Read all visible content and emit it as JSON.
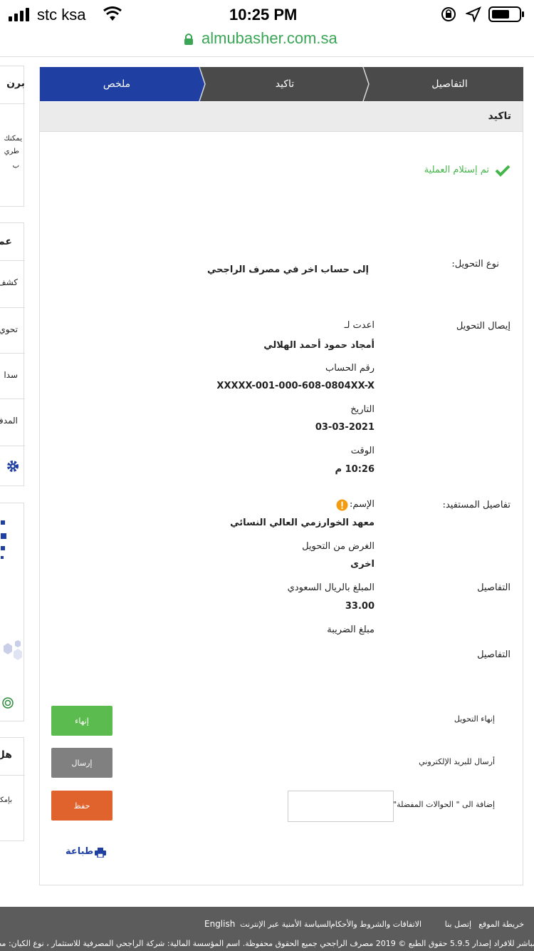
{
  "status_bar": {
    "carrier": "stc ksa",
    "time": "10:25 PM"
  },
  "url_bar": {
    "url": "almubasher.com.sa"
  },
  "sidebar": {
    "card1_title": "برن",
    "card1_text": [
      "يمكنك",
      "طري",
      "ب"
    ],
    "card2_title": "عم",
    "card2_items": [
      "كشف",
      "تحوي",
      "سدا",
      "المدف"
    ],
    "card4_title": "هل",
    "card4_text": "بإمكا"
  },
  "steps": {
    "details": "التفاصيل",
    "confirm": "تاكيد",
    "summary": "ملخص"
  },
  "section": {
    "title": "تاكيد"
  },
  "success": {
    "message": "تم إستلام العملية"
  },
  "transfer": {
    "type_label": "نوع التحويل:",
    "type_value": "إلى حساب اخر في مصرف الراجحي",
    "receipt_label": "إيصال التحويل",
    "prepared_for_label": "اعدت لـ",
    "prepared_for_value": "أمجاد حمود أحمد الهلالي",
    "account_label": "رقم الحساب",
    "account_value": "XXXXX-001-000-608-0804XX-X",
    "date_label": "التاريخ",
    "date_value": "03-03-2021",
    "time_label": "الوقت",
    "time_value": "10:26 م"
  },
  "beneficiary": {
    "section_label": "تفاصيل المستفيد:",
    "name_label": "الإسم:",
    "name_value": "معهد الخوارزمي العالي النسائي",
    "purpose_label": "الغرض من التحويل",
    "purpose_value": "اخرى",
    "details_label": "التفاصيل",
    "amount_label": "المبلغ بالريال السعودي",
    "amount_value": "33.00",
    "tax_label": "مبلغ الضريبة",
    "details_label_2": "التفاصيل"
  },
  "actions": {
    "finish_label": "إنهاء التحويل",
    "finish_button": "إنهاء",
    "email_label": "أرسال للبريد الإلكتروني",
    "email_button": "إرسال",
    "favorites_label": "إضافة الى \" الحوالات المفضلة\"",
    "favorites_input_value": "",
    "save_button": "حفظ",
    "print_link": "طباعة"
  },
  "footer": {
    "links": [
      "خريطة الموقع",
      "إتصل بنا",
      "الاتفاقات والشروط والأحكام",
      "السياسة الأمنية عبر الإنترنت",
      "English"
    ],
    "copyright": "مباشر للافراد إصدار 5.9.5 حقوق الطبع © 2019 مصرف الراجحي جميع الحقوق محفوظة. اسم المؤسسة المالية: شركة الراجحي المصرفية للاستثمار ، نوع الكيان: مص"
  },
  "colors": {
    "step_active": "#1f3fa3",
    "step_inactive": "#4a4a4a",
    "success": "#43b549",
    "finish_button": "#5cbb4e",
    "send_button": "#808080",
    "save_button": "#e0632d",
    "print_link": "#1f3fa3",
    "footer_bg": "#5c5c5c",
    "url": "#3aa655"
  }
}
